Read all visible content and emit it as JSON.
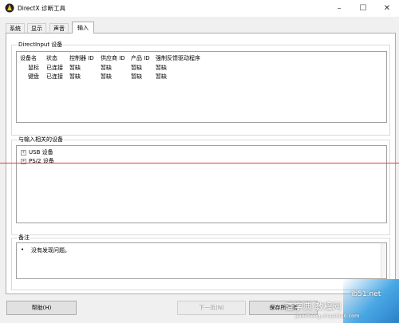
{
  "window": {
    "title": "DirectX 诊断工具"
  },
  "tabs": [
    {
      "label": "系统"
    },
    {
      "label": "显示"
    },
    {
      "label": "声音"
    },
    {
      "label": "输入"
    }
  ],
  "directinput": {
    "label": "DirectInput 设备",
    "columns": [
      "设备名",
      "状态",
      "控制器 ID",
      "供应商 ID",
      "产品 ID",
      "强制反馈驱动程序"
    ],
    "rows": [
      [
        "鼠标",
        "已连接",
        "暂缺",
        "暂缺",
        "暂缺",
        "暂缺"
      ],
      [
        "键盘",
        "已连接",
        "暂缺",
        "暂缺",
        "暂缺",
        "暂缺"
      ]
    ]
  },
  "related": {
    "label": "与输入相关的设备",
    "items": [
      {
        "label": "USB 设备",
        "icon": "expand-plus-icon"
      },
      {
        "label": "PS/2 设备",
        "icon": "expand-plus-icon"
      }
    ]
  },
  "notes": {
    "label": "备注",
    "items": [
      "没有发现问题。"
    ]
  },
  "buttons": {
    "help": "帮助(H)",
    "next": "下一页(N)",
    "save": "保存所有信"
  },
  "watermark": {
    "site": "ib51.net",
    "brand": "查字典 教程网",
    "url": "jiaocheng.chazidian.com"
  },
  "colors": {
    "accent": "#2b7fc6",
    "redline": "#e53935"
  }
}
